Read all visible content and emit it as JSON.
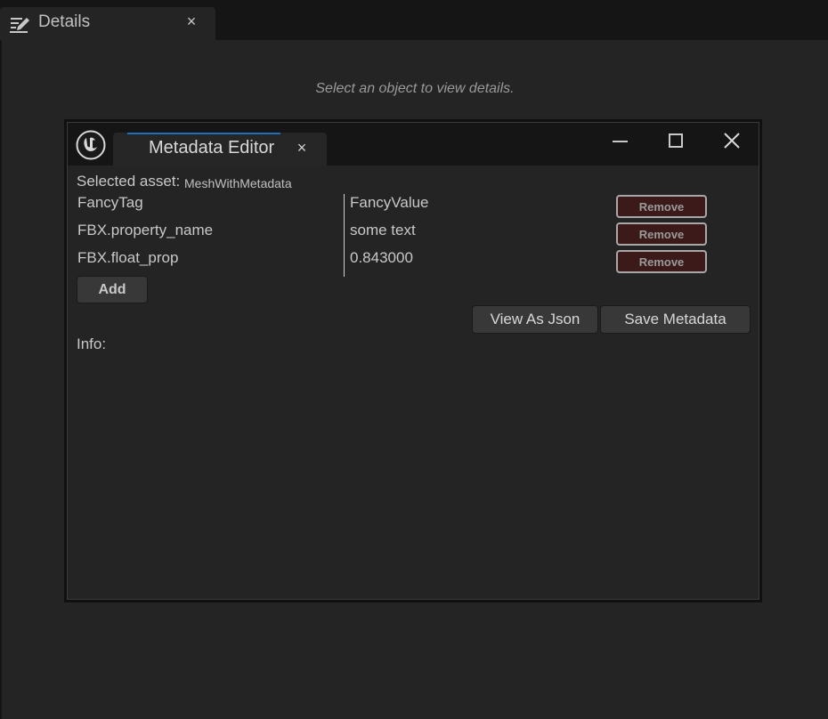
{
  "outer_tab": {
    "title": "Details",
    "close_glyph": "×",
    "icon": "details-pen-icon"
  },
  "details": {
    "hint": "Select an object to view details."
  },
  "window": {
    "logo_icon": "unreal-logo-icon",
    "tab_title": "Metadata Editor",
    "tab_close_glyph": "×",
    "controls": [
      "minimize-icon",
      "maximize-icon",
      "close-icon"
    ],
    "accent_color": "#1f6fb8"
  },
  "editor": {
    "selected_label": "Selected asset:",
    "selected_value": "MeshWithMetadata",
    "rows": [
      {
        "key": "FancyTag",
        "value": "FancyValue",
        "remove_label": "Remove"
      },
      {
        "key": "FBX.property_name",
        "value": "some text",
        "remove_label": "Remove"
      },
      {
        "key": "FBX.float_prop",
        "value": "0.843000",
        "remove_label": "Remove"
      }
    ],
    "add_label": "Add",
    "view_json_label": "View As Json",
    "save_label": "Save Metadata",
    "info_label": "Info:"
  }
}
